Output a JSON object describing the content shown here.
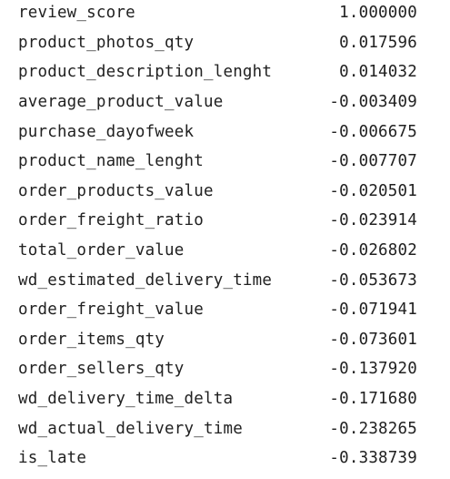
{
  "rows": [
    {
      "name": "review_score",
      "value": "1.000000"
    },
    {
      "name": "product_photos_qty",
      "value": "0.017596"
    },
    {
      "name": "product_description_lenght",
      "value": "0.014032"
    },
    {
      "name": "average_product_value",
      "value": "-0.003409"
    },
    {
      "name": "purchase_dayofweek",
      "value": "-0.006675"
    },
    {
      "name": "product_name_lenght",
      "value": "-0.007707"
    },
    {
      "name": "order_products_value",
      "value": "-0.020501"
    },
    {
      "name": "order_freight_ratio",
      "value": "-0.023914"
    },
    {
      "name": "total_order_value",
      "value": "-0.026802"
    },
    {
      "name": "wd_estimated_delivery_time",
      "value": "-0.053673"
    },
    {
      "name": "order_freight_value",
      "value": "-0.071941"
    },
    {
      "name": "order_items_qty",
      "value": "-0.073601"
    },
    {
      "name": "order_sellers_qty",
      "value": "-0.137920"
    },
    {
      "name": "wd_delivery_time_delta",
      "value": "-0.171680"
    },
    {
      "name": "wd_actual_delivery_time",
      "value": "-0.238265"
    },
    {
      "name": "is_late",
      "value": "-0.338739"
    }
  ]
}
